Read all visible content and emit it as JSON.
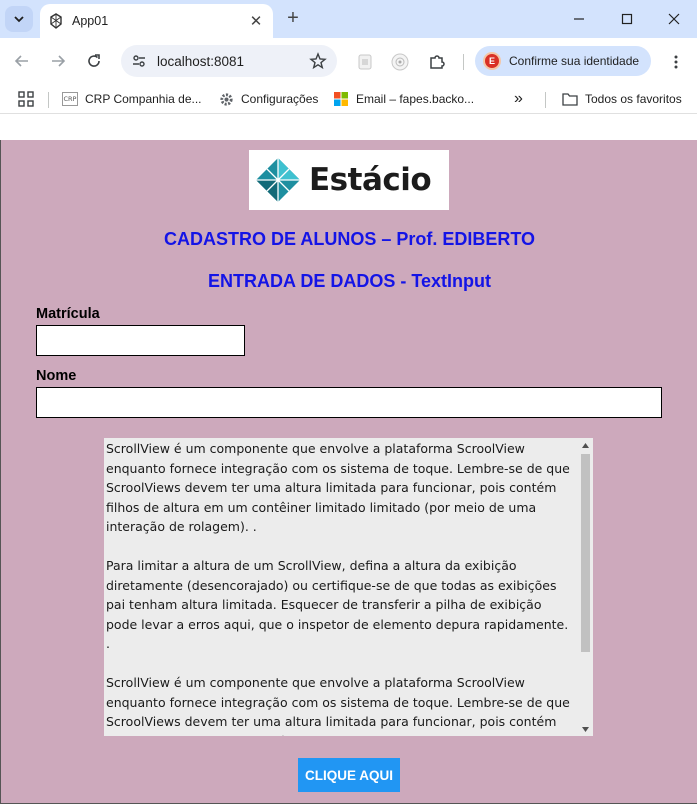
{
  "browser": {
    "tab_title": "App01",
    "url": "localhost:8081",
    "profile_label": "Confirme sua identidade",
    "profile_initial": "E",
    "bookmarks": [
      {
        "label": "CRP Companhia de...",
        "icon": "crp-favicon"
      },
      {
        "label": "Configurações",
        "icon": "gear-icon"
      },
      {
        "label": "Email – fapes.backo...",
        "icon": "microsoft-icon"
      }
    ],
    "more_bookmarks": "»",
    "all_bookmarks": "Todos os favoritos",
    "colors": {
      "tabstrip": "#d3e3fd",
      "pill": "#d3e3fd"
    }
  },
  "app": {
    "logo_text": "Estácio",
    "title": "CADASTRO DE ALUNOS – Prof. EDIBERTO",
    "subtitle": "ENTRADA DE DADOS - TextInput",
    "fields": {
      "matricula_label": "Matrícula",
      "matricula_value": "",
      "nome_label": "Nome",
      "nome_value": ""
    },
    "scroll_paragraphs": [
      "ScrollView é um componente que envolve a plataforma ScroolView enquanto fornece integração com os sistema de toque. Lembre-se de que ScroolViews devem ter uma altura limitada para funcionar, pois contém filhos de altura em um contêiner limitado limitado (por meio de uma interação de rolagem). .",
      "Para limitar a altura de um ScrollView, defina a altura da exibição diretamente (desencorajado) ou certifique-se de que todas as exibições pai tenham altura limitada. Esquecer de transferir a pilha de exibição pode levar a erros aqui, que o inspetor de elemento depura rapidamente. .",
      "ScrollView é um componente que envolve a plataforma ScroolView enquanto fornece integração com os sistema de toque. Lembre-se de que ScroolViews devem ter uma altura limitada para funcionar, pois contém filhos de altura em um contêiner limitado limitado (por meio de uma interação de rolagem). ."
    ],
    "button_label": "CLIQUE AQUI",
    "colors": {
      "background": "#cda9bc",
      "title": "#1414e6",
      "button": "#2196f3",
      "scroll_bg": "#ececec"
    }
  }
}
